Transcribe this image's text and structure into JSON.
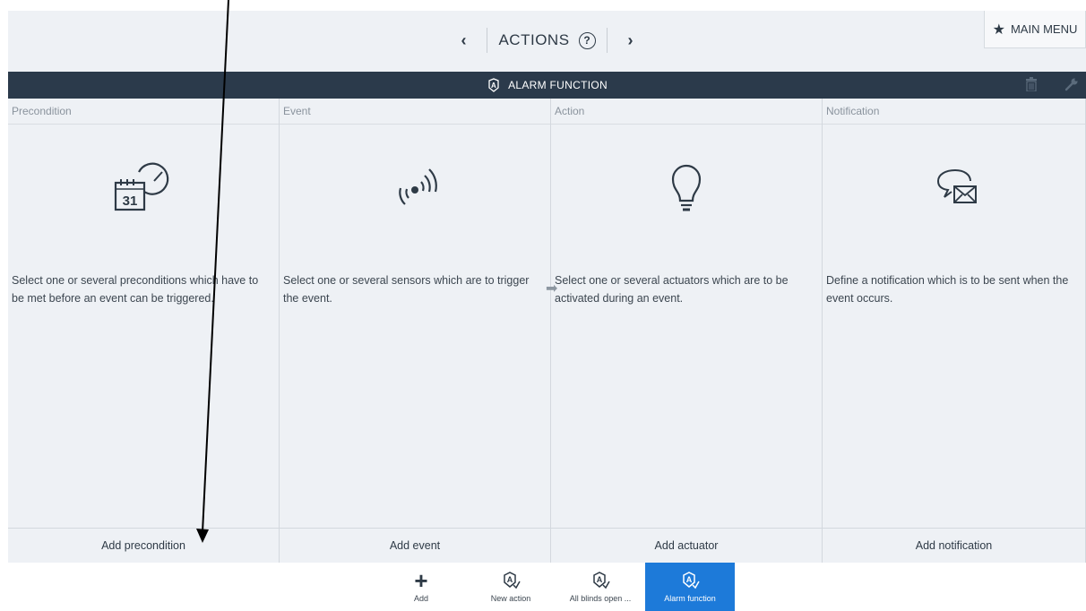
{
  "header": {
    "title": "ACTIONS",
    "help_glyph": "?",
    "prev_glyph": "‹",
    "next_glyph": "›",
    "main_menu_label": "MAIN MENU"
  },
  "titlebar": {
    "title": "ALARM FUNCTION"
  },
  "columns": [
    {
      "id": "precondition",
      "header": "Precondition",
      "description": "Select one or several preconditions which have to be met before an event can be triggered.",
      "button": "Add precondition",
      "icon": "calendar-clock-icon",
      "calendar_day": "31"
    },
    {
      "id": "event",
      "header": "Event",
      "description": "Select one or several sensors which are to trigger the event.",
      "button": "Add event",
      "icon": "sensor-waves-icon"
    },
    {
      "id": "action",
      "header": "Action",
      "description": "Select one or several actuators which are to be activated during an event.",
      "button": "Add actuator",
      "icon": "lightbulb-icon"
    },
    {
      "id": "notification",
      "header": "Notification",
      "description": "Define a notification which is to be sent when the event occurs.",
      "button": "Add notification",
      "icon": "message-envelope-icon"
    }
  ],
  "dock": [
    {
      "label": "Add",
      "icon": "plus-icon",
      "active": false
    },
    {
      "label": "New action",
      "icon": "action-icon",
      "active": false
    },
    {
      "label": "All blinds open ...",
      "icon": "action-icon",
      "active": false
    },
    {
      "label": "Alarm function",
      "icon": "action-icon",
      "active": true
    }
  ],
  "colors": {
    "titlebar_bg": "#2b3a4b",
    "accent": "#1d7ad9",
    "panel_bg": "#eef1f5"
  }
}
